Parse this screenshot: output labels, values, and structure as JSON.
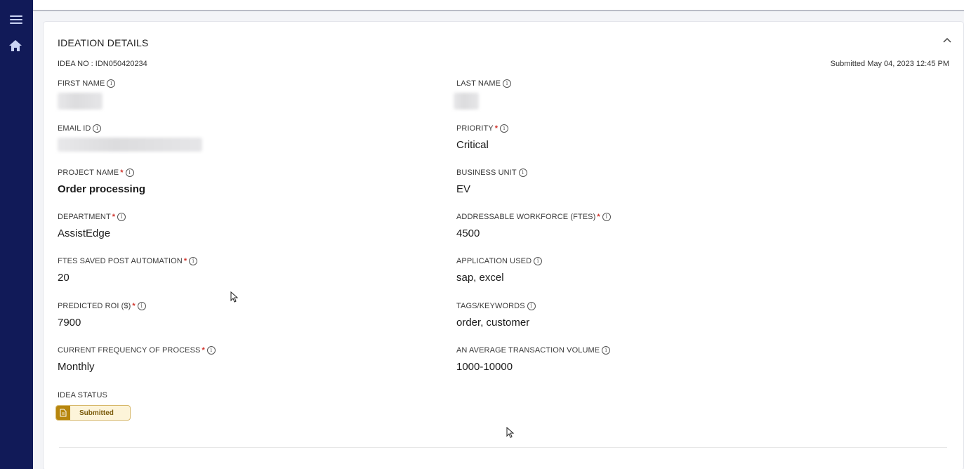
{
  "card": {
    "title": "IDEATION DETAILS",
    "idea_no": "IDEA NO : IDN050420234",
    "submitted": "Submitted May 04, 2023 12:45 PM"
  },
  "fields_left": [
    {
      "label": "FIRST NAME",
      "required": false,
      "value": "",
      "redacted": true
    },
    {
      "label": "EMAIL ID",
      "required": false,
      "value": "",
      "redacted": true
    },
    {
      "label": "PROJECT NAME",
      "required": true,
      "value": "Order processing"
    },
    {
      "label": "DEPARTMENT",
      "required": true,
      "value": "AssistEdge"
    },
    {
      "label": "FTES SAVED POST AUTOMATION",
      "required": true,
      "value": "20"
    },
    {
      "label": "PREDICTED ROI ($)",
      "required": true,
      "value": "7900"
    },
    {
      "label": "CURRENT FREQUENCY OF PROCESS",
      "required": true,
      "value": "Monthly"
    }
  ],
  "fields_right": [
    {
      "label": "LAST NAME",
      "required": false,
      "value": "",
      "redacted": true
    },
    {
      "label": "PRIORITY",
      "required": true,
      "value": "Critical"
    },
    {
      "label": "BUSINESS UNIT",
      "required": false,
      "value": "EV"
    },
    {
      "label": "ADDRESSABLE WORKFORCE (FTES)",
      "required": true,
      "value": "4500"
    },
    {
      "label": "APPLICATION USED",
      "required": false,
      "value": "sap, excel"
    },
    {
      "label": "TAGS/KEYWORDS",
      "required": false,
      "value": "order, customer"
    },
    {
      "label": "AN AVERAGE TRANSACTION VOLUME",
      "required": false,
      "value": "1000-10000"
    }
  ],
  "idea_status": {
    "label": "IDEA STATUS",
    "badge": "Submitted"
  },
  "required_marker": "*",
  "info_glyph": "i",
  "icons": {
    "menu": "hamburger-menu-icon",
    "home": "home-icon",
    "collapse": "chevron-up-icon",
    "info": "info-icon",
    "status": "document-icon"
  },
  "colors": {
    "sidebar": "#111a58",
    "required": "#d0342c",
    "badge_bg": "#fdf4d9",
    "badge_accent": "#b7860e"
  }
}
